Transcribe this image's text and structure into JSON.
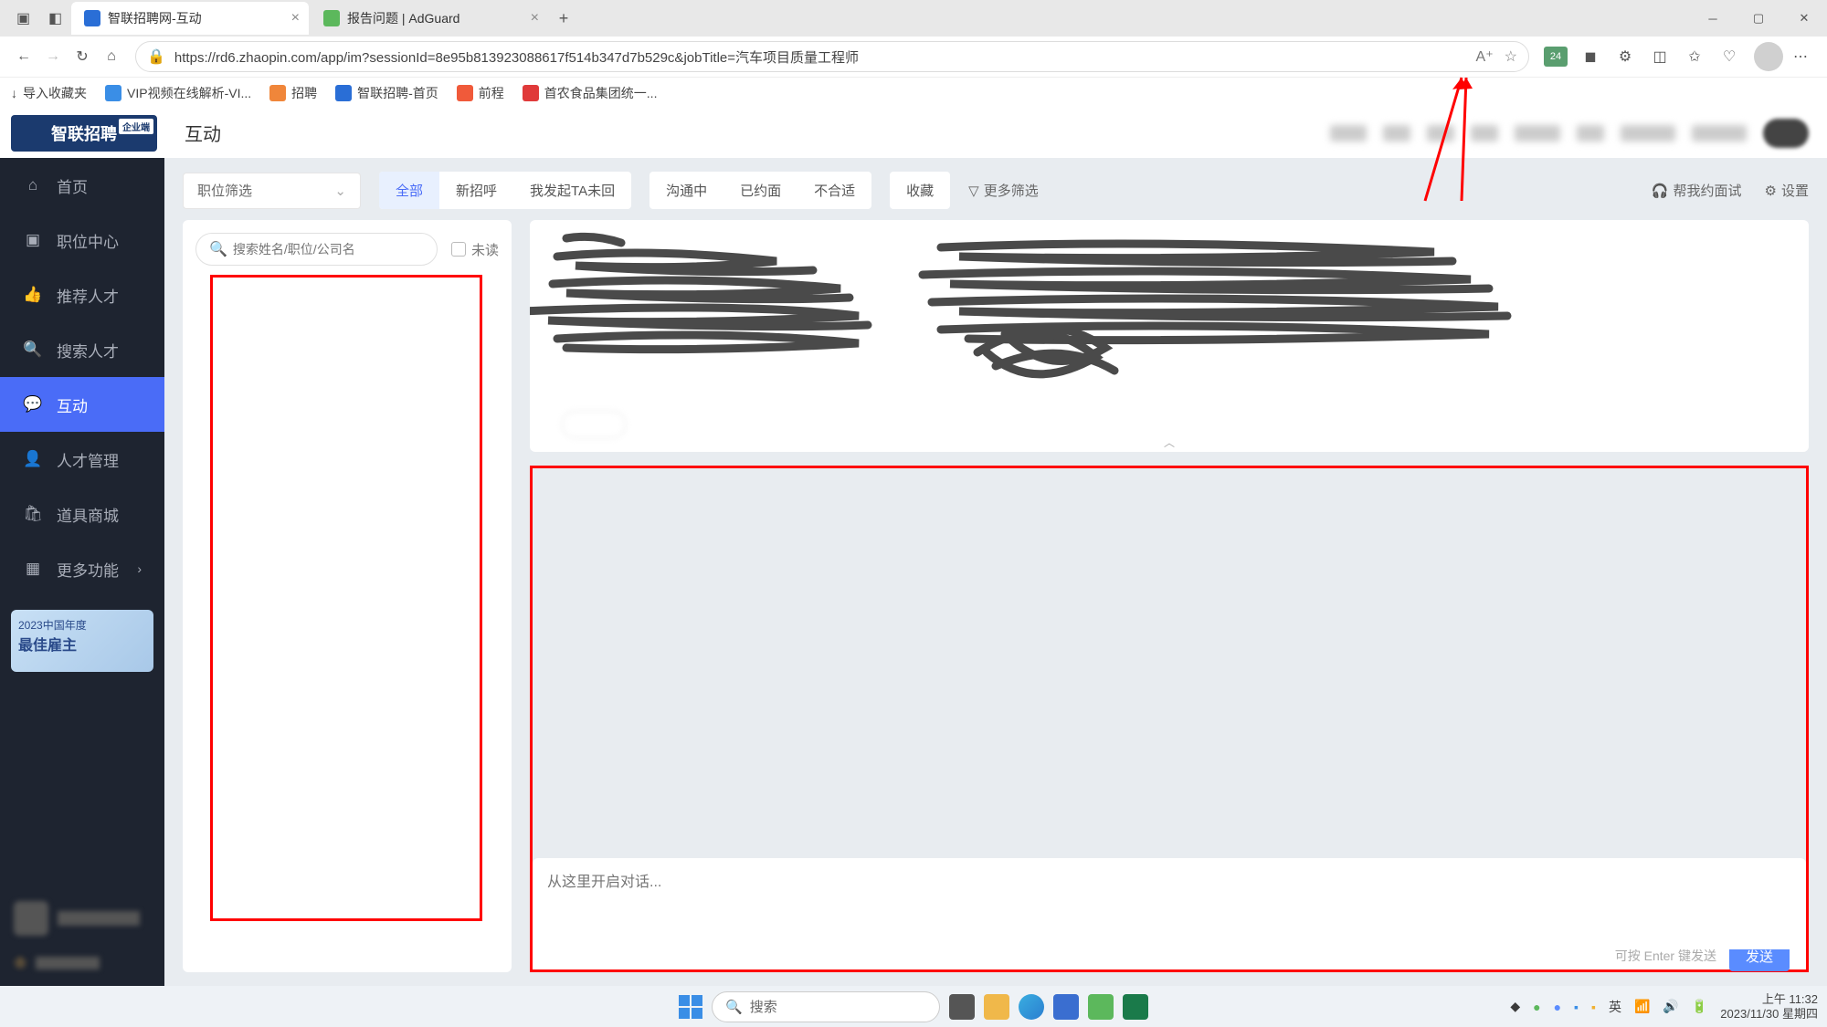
{
  "browser": {
    "tabs": [
      {
        "title": "智联招聘网-互动",
        "active": true
      },
      {
        "title": "报告问题 | AdGuard",
        "active": false
      }
    ],
    "url": "https://rd6.zhaopin.com/app/im?sessionId=8e95b813923088617f514b347d7b529c&jobTitle=汽车项目质量工程师",
    "adguard_count": "24"
  },
  "bookmarks": {
    "import": "导入收藏夹",
    "items": [
      "VIP视频在线解析-VI...",
      "招聘",
      "智联招聘-首页",
      "前程",
      "首农食品集团统一..."
    ]
  },
  "header": {
    "logo": "智联招聘",
    "logo_tag": "企业端",
    "title": "互动"
  },
  "sidebar": {
    "items": [
      {
        "icon": "home",
        "label": "首页"
      },
      {
        "icon": "briefcase",
        "label": "职位中心"
      },
      {
        "icon": "thumb",
        "label": "推荐人才"
      },
      {
        "icon": "search",
        "label": "搜索人才"
      },
      {
        "icon": "chat",
        "label": "互动",
        "active": true
      },
      {
        "icon": "person",
        "label": "人才管理"
      },
      {
        "icon": "shop",
        "label": "道具商城"
      },
      {
        "icon": "grid",
        "label": "更多功能",
        "arrow": true
      }
    ],
    "banner_title": "2023中国年度",
    "banner_sub": "最佳雇主"
  },
  "filters": {
    "position_label": "职位筛选",
    "tabs": [
      "全部",
      "新招呼",
      "我发起TA未回",
      "沟通中",
      "已约面",
      "不合适",
      "收藏"
    ],
    "more": "更多筛选",
    "help": "帮我约面试",
    "settings": "设置"
  },
  "search": {
    "placeholder": "搜索姓名/职位/公司名",
    "unread": "未读"
  },
  "chat": {
    "placeholder": "从这里开启对话...",
    "enter_hint": "可按 Enter 键发送",
    "send": "发送"
  },
  "taskbar": {
    "search": "搜索",
    "ime": "英",
    "time": "上午 11:32",
    "date": "2023/11/30 星期四"
  }
}
